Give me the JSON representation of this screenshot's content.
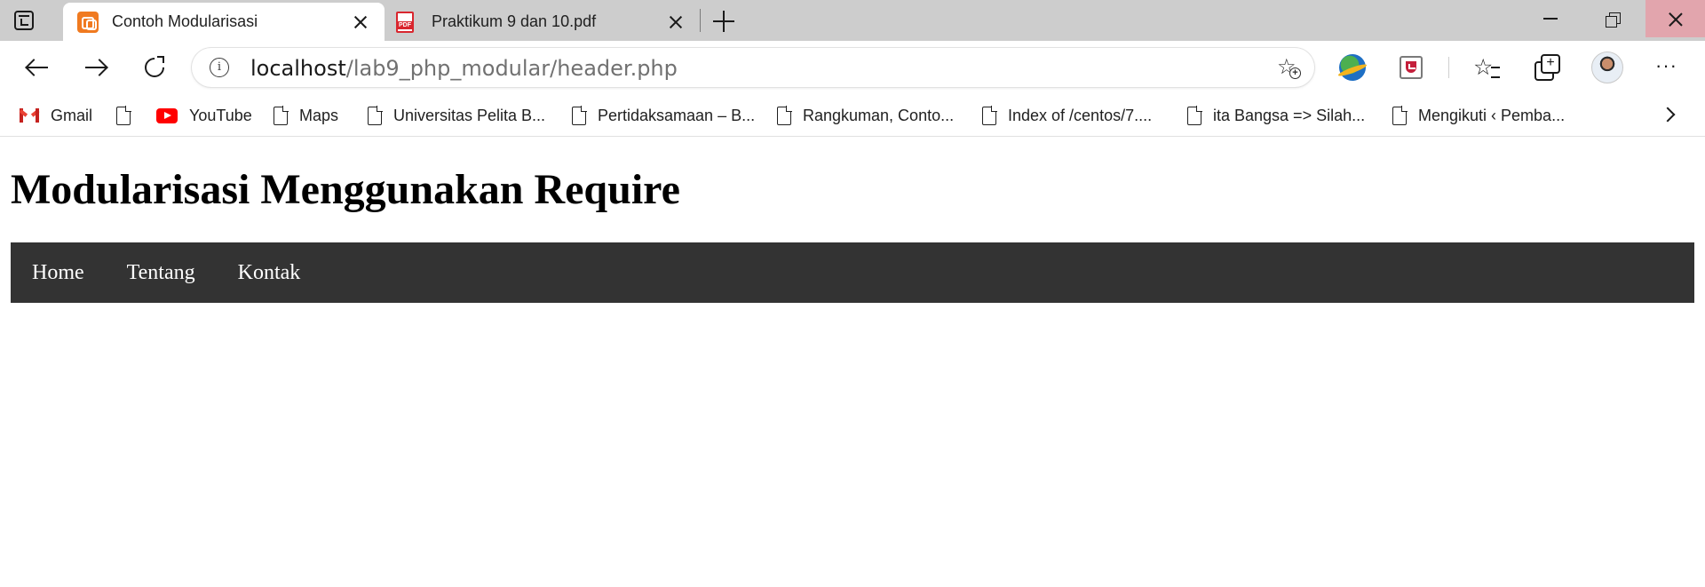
{
  "browser": {
    "tabs": [
      {
        "title": "Contoh Modularisasi",
        "favicon": "xampp-icon",
        "active": true
      },
      {
        "title": "Praktikum 9 dan 10.pdf",
        "favicon": "pdf-icon",
        "active": false
      }
    ],
    "pdf_badge": "PDF",
    "address": {
      "host": "localhost",
      "path": "/lab9_php_modular/header.php",
      "info_glyph": "i"
    },
    "bookmarks": [
      {
        "label": "Gmail",
        "icon": "gmail-icon"
      },
      {
        "label": "",
        "icon": "page-icon"
      },
      {
        "label": "YouTube",
        "icon": "youtube-icon"
      },
      {
        "label": "Maps",
        "icon": "page-icon"
      },
      {
        "label": "Universitas Pelita B...",
        "icon": "page-icon"
      },
      {
        "label": "Pertidaksamaan – B...",
        "icon": "page-icon"
      },
      {
        "label": "Rangkuman, Conto...",
        "icon": "page-icon"
      },
      {
        "label": "Index of /centos/7....",
        "icon": "page-icon"
      },
      {
        "label": "ita Bangsa => Silah...",
        "icon": "page-icon"
      },
      {
        "label": "Mengikuti ‹ Pemba...",
        "icon": "page-icon"
      }
    ],
    "more_glyph": "···",
    "star_glyph": "☆",
    "favorites_glyph": "☆"
  },
  "page": {
    "title": "Modularisasi Menggunakan Require",
    "nav": [
      "Home",
      "Tentang",
      "Kontak"
    ],
    "nav_background": "#333333",
    "nav_text_color": "#ffffff"
  }
}
